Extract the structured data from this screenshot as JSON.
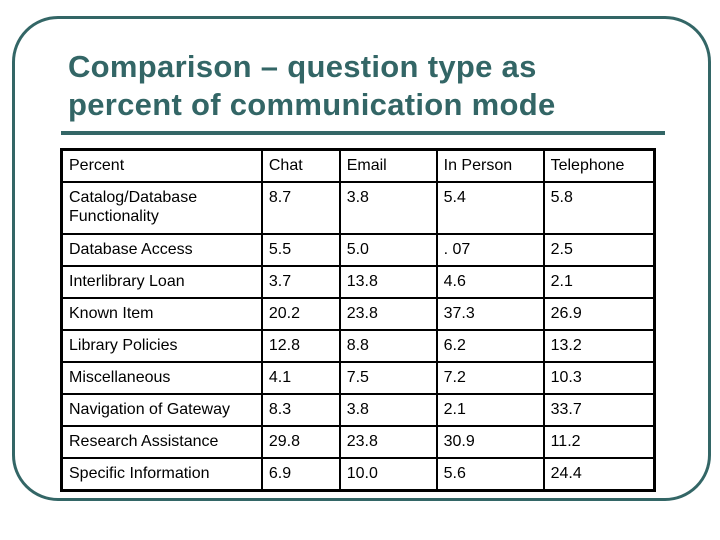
{
  "slide": {
    "title_line1": "Comparison – question type as",
    "title_line2": "percent of communication mode",
    "accent_color": "#336666"
  },
  "table": {
    "headers": [
      "Percent",
      "Chat",
      "Email",
      "In Person",
      "Telephone"
    ],
    "rows": [
      [
        "Catalog/Database Functionality",
        "8.7",
        "3.8",
        "5.4",
        "5.8"
      ],
      [
        "Database Access",
        "5.5",
        "5.0",
        ". 07",
        "2.5"
      ],
      [
        "Interlibrary Loan",
        "3.7",
        "13.8",
        "4.6",
        "2.1"
      ],
      [
        "Known Item",
        "20.2",
        "23.8",
        "37.3",
        "26.9"
      ],
      [
        "Library Policies",
        "12.8",
        "8.8",
        "6.2",
        "13.2"
      ],
      [
        "Miscellaneous",
        "4.1",
        "7.5",
        "7.2",
        "10.3"
      ],
      [
        "Navigation of Gateway",
        "8.3",
        "3.8",
        "2.1",
        "33.7"
      ],
      [
        "Research Assistance",
        "29.8",
        "23.8",
        "30.9",
        "11.2"
      ],
      [
        "Specific Information",
        "6.9",
        "10.0",
        "5.6",
        "24.4"
      ]
    ]
  }
}
